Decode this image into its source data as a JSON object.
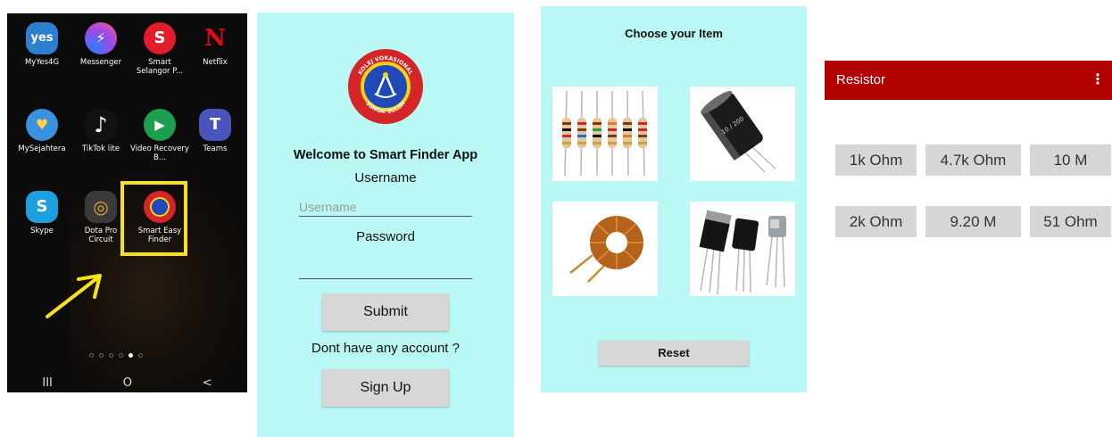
{
  "home": {
    "apps": [
      {
        "label": "MyYes4G",
        "glyph": "yes",
        "color": "#2d7fd2",
        "icon": "yes-app-icon"
      },
      {
        "label": "Messenger",
        "glyph": "⚡",
        "color": "#a347e6",
        "icon": "messenger-icon"
      },
      {
        "label": "Smart Selangor P...",
        "glyph": "S",
        "color": "#e21c2b",
        "icon": "smart-selangor-icon"
      },
      {
        "label": "Netflix",
        "glyph": "N",
        "color": "#0b0b0b",
        "icon": "netflix-icon"
      },
      {
        "label": "MySejahtera",
        "glyph": "♥",
        "color": "#3b90df",
        "icon": "mysejahtera-icon"
      },
      {
        "label": "TikTok lite",
        "glyph": "♪",
        "color": "#111111",
        "icon": "tiktok-icon"
      },
      {
        "label": "Video Recovery B...",
        "glyph": "▶",
        "color": "#1e9f4f",
        "icon": "video-recovery-icon"
      },
      {
        "label": "Teams",
        "glyph": "T",
        "color": "#4b53bc",
        "icon": "teams-icon"
      },
      {
        "label": "Skype",
        "glyph": "S",
        "color": "#1d9fe0",
        "icon": "skype-icon"
      },
      {
        "label": "Dota Pro Circuit",
        "glyph": "◎",
        "color": "#3a3a3a",
        "icon": "dota-icon"
      },
      {
        "label": "Smart Easy Finder",
        "glyph": "",
        "color": "#d42527",
        "icon": "smart-easy-finder-icon"
      }
    ],
    "highlight_color": "#f6e11b",
    "arrow_color": "#f6e11b",
    "nav": {
      "recents": "III",
      "home": "O",
      "back": "<"
    }
  },
  "login": {
    "welcome": "Welcome to Smart Finder App",
    "username_label": "Username",
    "username_placeholder": "Username",
    "password_label": "Password",
    "submit": "Submit",
    "no_account": "Dont have any account ?",
    "signup": "Sign Up",
    "logo_text_top": "KOLEJ VOKASIONAL",
    "logo_text_bottom": "SUNGAI BULOH",
    "bg": "#b9f8f5"
  },
  "items": {
    "title": "Choose your Item",
    "reset": "Reset",
    "cap_text": "10 / 200"
  },
  "resistor": {
    "title": "Resistor",
    "menu": "⋮",
    "header_color": "#b00000",
    "values": [
      "1k Ohm",
      "4.7k Ohm",
      "10 M",
      "2k Ohm",
      "9.20 M",
      "51 Ohm"
    ]
  }
}
